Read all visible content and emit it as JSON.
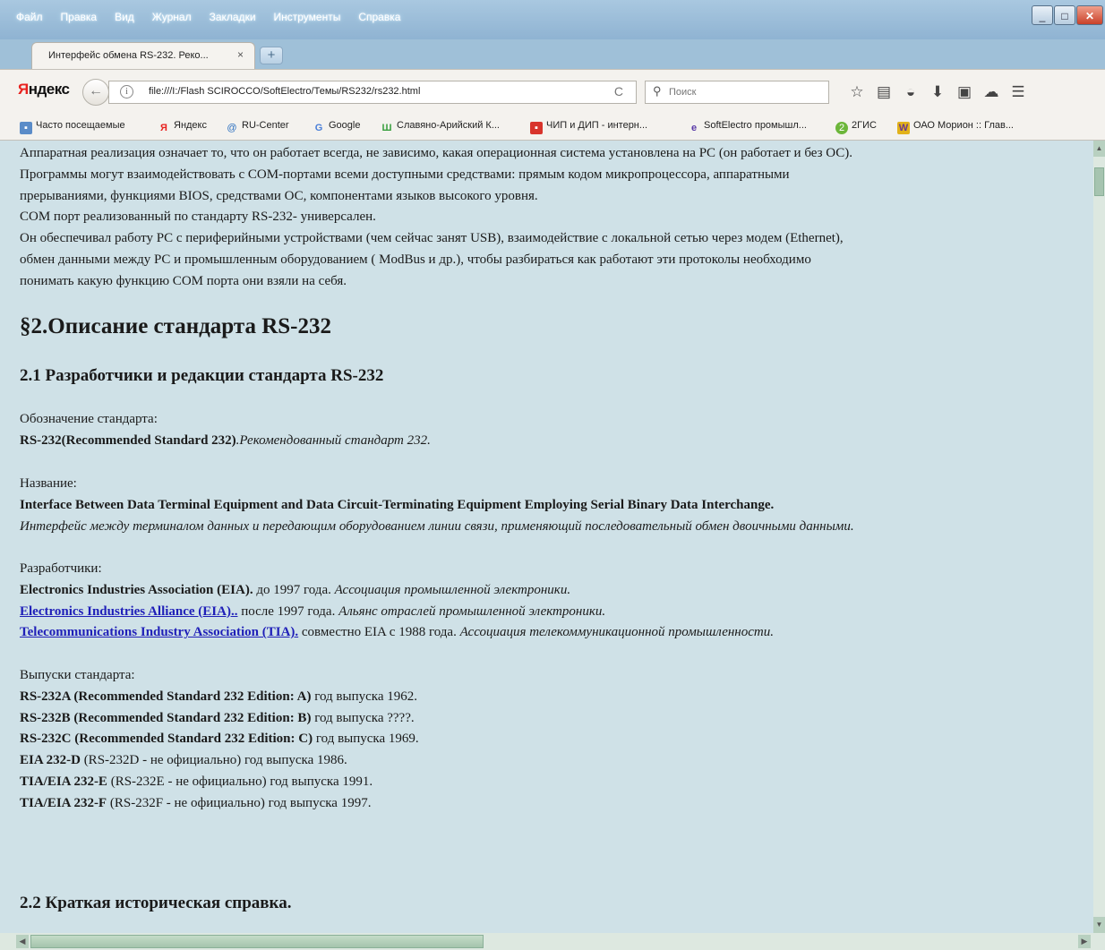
{
  "menu": [
    "Файл",
    "Правка",
    "Вид",
    "Журнал",
    "Закладки",
    "Инструменты",
    "Справка"
  ],
  "window_buttons": {
    "minimize": "_",
    "maximize": "□",
    "close": "✕"
  },
  "tab": {
    "title": "Интерфейс обмена RS-232. Реко...",
    "close": "×"
  },
  "new_tab": "+",
  "nav": {
    "brand_first": "Я",
    "brand_rest": "ндекс",
    "back": "←",
    "info": "i",
    "url": "file:///I:/Flash SCIROCCO/SoftElectro/Темы/RS232/rs232.html",
    "reload": "C",
    "search_placeholder": "Поиск",
    "search_icon": "⚲"
  },
  "toolbar_icons": [
    "☆",
    "▤",
    "◒",
    "⬇",
    "▣",
    "☁",
    "☰"
  ],
  "bookmarks": [
    "Часто посещаемые",
    "Яндекс",
    "RU-Center",
    "Google",
    "Славяно-Арийский К...",
    "ЧИП и ДИП - интерн...",
    "SoftElectro промышл...",
    "2ГИС",
    "ОАО Морион :: Глав..."
  ],
  "content": {
    "intro": [
      "Аппаратная реализация означает то, что он работает всегда, не зависимо, какая операционная система установлена на PC (он работает и без ОС).",
      "Программы могут взаимодействовать с COM-портами всеми доступными средствами: прямым кодом микропроцессора, аппаратными",
      "прерываниями, функциями BIOS, средствами ОС, компонентами языков высокого уровня.",
      "COM порт реализованный по стандарту RS-232- универсален.",
      "Он обеспечивал работу PC с периферийными устройствами (чем сейчас занят USB), взаимодействие с локальной сетью через модем (Ethernet),",
      "обмен данными между PC и промышленным оборудованием ( ModBus и др.), чтобы разбираться как работают эти протоколы необходимо",
      "понимать какую функцию COM порта они взяли на себя."
    ],
    "section_title": "§2.Описание стандарта RS-232",
    "sub1": "2.1 Разработчики и редакции стандарта RS-232",
    "designation": {
      "label": "Обозначение стандарта:",
      "bold": "RS-232(Recommended Standard 232)",
      "italic": ".Рекомендованный стандарт 232."
    },
    "name": {
      "label": "Название:",
      "bold": "Interface Between Data Terminal Equipment and Data Circuit-Terminating Equipment Employing Serial Binary Data Interchange.",
      "italic": "Интерфейс между терминалом данных и передающим оборудованием линии связи, применяющий последовательный обмен двоичными данными."
    },
    "developers": {
      "label": "Разработчики:",
      "items": [
        {
          "org": "Electronics Industries Association (EIA).",
          "text": " до 1997 года.",
          "italic": " Ассоциация промышленной электроники."
        },
        {
          "org": "Electronics Industries Alliance (EIA)..",
          "text": "  после 1997 года.",
          "italic": " Альянс отраслей промышленной электроники."
        },
        {
          "org": "Telecommunications Industry Association (TIA).",
          "text": "  совместно EIA с 1988 года.",
          "italic": " Ассоциация телекоммуникационной промышленности."
        }
      ]
    },
    "releases": {
      "label": "Выпуски стандарта:",
      "items": [
        {
          "bold": "RS-232A (Recommended Standard 232 Edition: A)",
          "text": " год выпуска 1962."
        },
        {
          "bold": "RS-232B (Recommended Standard 232 Edition: B)",
          "text": " год выпуска ????."
        },
        {
          "bold": "RS-232C (Recommended Standard 232 Edition: C)",
          "text": " год выпуска 1969."
        },
        {
          "bold": "EIA 232-D",
          "text": " (RS-232D - не официально) год выпуска 1986."
        },
        {
          "bold": "TIA/EIA 232-E",
          "text": " (RS-232E - не официально) год выпуска 1991."
        },
        {
          "bold": "TIA/EIA 232-F",
          "text": " (RS-232F - не официально) год выпуска 1997."
        }
      ]
    },
    "sub2": "2.2 Краткая историческая справка."
  },
  "scroll": {
    "up": "▲",
    "down": "▼",
    "left": "◀",
    "right": "▶"
  },
  "colors": {
    "page_bg": "#cfe1e7",
    "link": "#1f1fb8",
    "brand_red": "#e8221f",
    "chrome_blue": "#9fc0d8"
  }
}
